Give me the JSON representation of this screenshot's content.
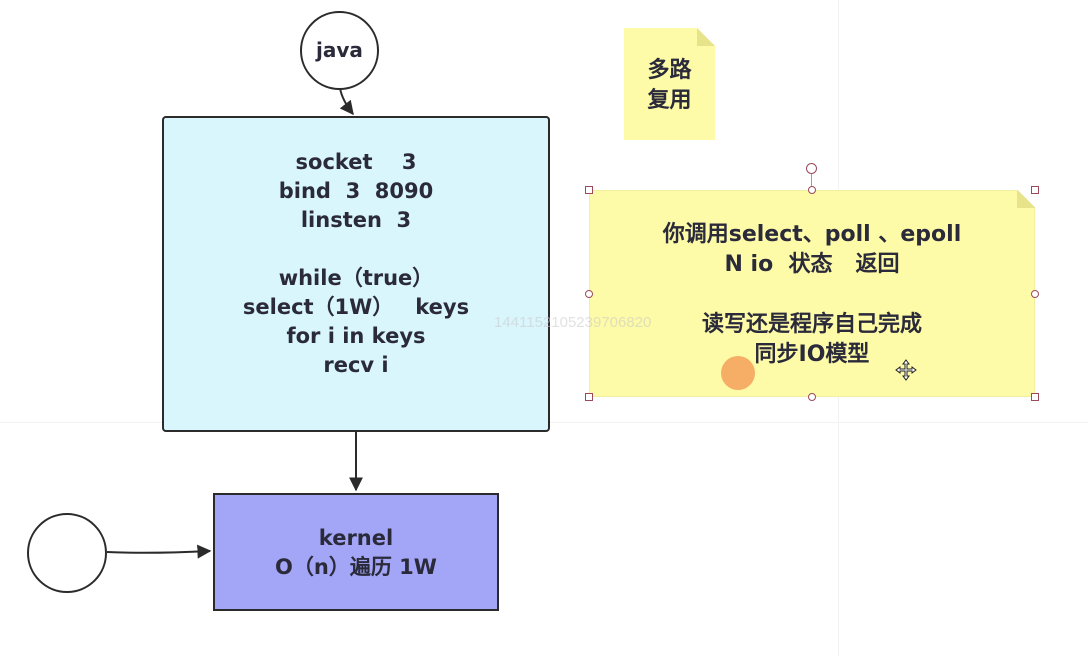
{
  "nodes": {
    "java": {
      "label": "java"
    },
    "main": {
      "lines": [
        "socket    3",
        "bind  3  8090",
        "linsten  3",
        "",
        "while（true）",
        "select（1W）   keys",
        "for i in keys",
        "recv i"
      ]
    },
    "kernel": {
      "lines": [
        "kernel",
        "O（n）遍历 1W"
      ]
    },
    "note_small": {
      "lines": [
        "多路",
        "复用"
      ]
    },
    "note_large": {
      "lines": [
        "你调用select、poll 、epoll",
        "N io  状态   返回",
        "",
        "读写还是程序自己完成",
        "同步IO模型"
      ]
    }
  },
  "watermark": "1441152105239706820",
  "colors": {
    "main_fill": "#d9f6fd",
    "kernel_fill": "#a3a6f7",
    "note_fill": "#fdfba7",
    "note_fold": "#e6e38a",
    "stroke": "#2b2b2b",
    "cursor_dot": "#f5a05a"
  },
  "icons": {
    "cursor": "move-cursor-icon"
  }
}
